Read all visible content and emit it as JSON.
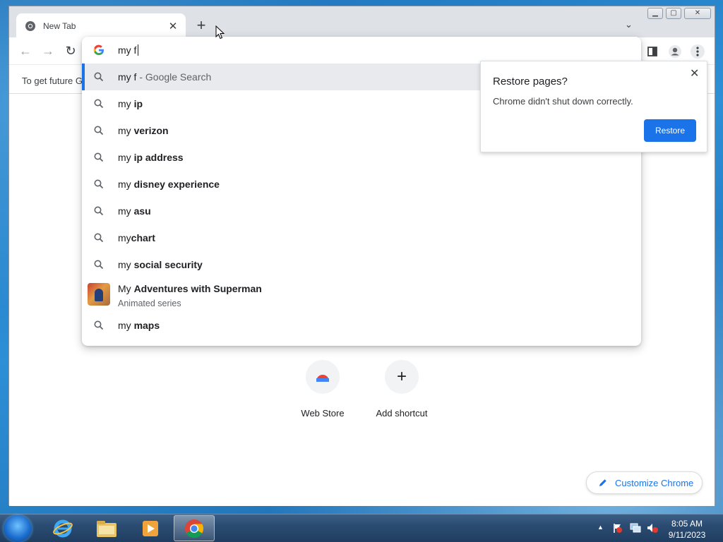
{
  "browser": {
    "tab": {
      "title": "New Tab",
      "close_glyph": "✕"
    },
    "new_tab_glyph": "+",
    "tab_search_glyph": "⌄",
    "window_controls": {
      "minimize": "▁",
      "maximize": "▢",
      "close": "✕"
    }
  },
  "omnibox": {
    "typed_text": "my f",
    "suggestions": [
      {
        "prefix": "my f",
        "bold": "",
        "suffix": " - Google Search",
        "type": "search",
        "selected": true
      },
      {
        "prefix": "my ",
        "bold": "ip",
        "suffix": "",
        "type": "search"
      },
      {
        "prefix": "my ",
        "bold": "verizon",
        "suffix": "",
        "type": "search"
      },
      {
        "prefix": "my ",
        "bold": "ip address",
        "suffix": "",
        "type": "search"
      },
      {
        "prefix": "my ",
        "bold": "disney experience",
        "suffix": "",
        "type": "search"
      },
      {
        "prefix": "my ",
        "bold": "asu",
        "suffix": "",
        "type": "search"
      },
      {
        "prefix": "my",
        "bold": "chart",
        "suffix": "",
        "type": "search"
      },
      {
        "prefix": "my ",
        "bold": "social security",
        "suffix": "",
        "type": "search"
      },
      {
        "prefix": "My ",
        "bold": "Adventures with Superman",
        "suffix": "",
        "type": "entity",
        "subtitle": "Animated series"
      },
      {
        "prefix": "my ",
        "bold": "maps",
        "suffix": "",
        "type": "search"
      }
    ]
  },
  "infobar": {
    "text": "To get future G"
  },
  "restore_bubble": {
    "title": "Restore pages?",
    "message": "Chrome didn't shut down correctly.",
    "button": "Restore",
    "close_glyph": "✕"
  },
  "new_tab_page": {
    "shortcuts": [
      {
        "label": "Web Store"
      },
      {
        "label": "Add shortcut",
        "glyph": "+"
      }
    ],
    "customize_label": "Customize Chrome"
  },
  "taskbar": {
    "clock": {
      "time": "8:05 AM",
      "date": "9/11/2023"
    },
    "tray_arrow": "▲"
  },
  "colors": {
    "accent": "#1a73e8",
    "tab_strip": "#dee1e6",
    "selected_suggestion": "#e8eaed"
  }
}
